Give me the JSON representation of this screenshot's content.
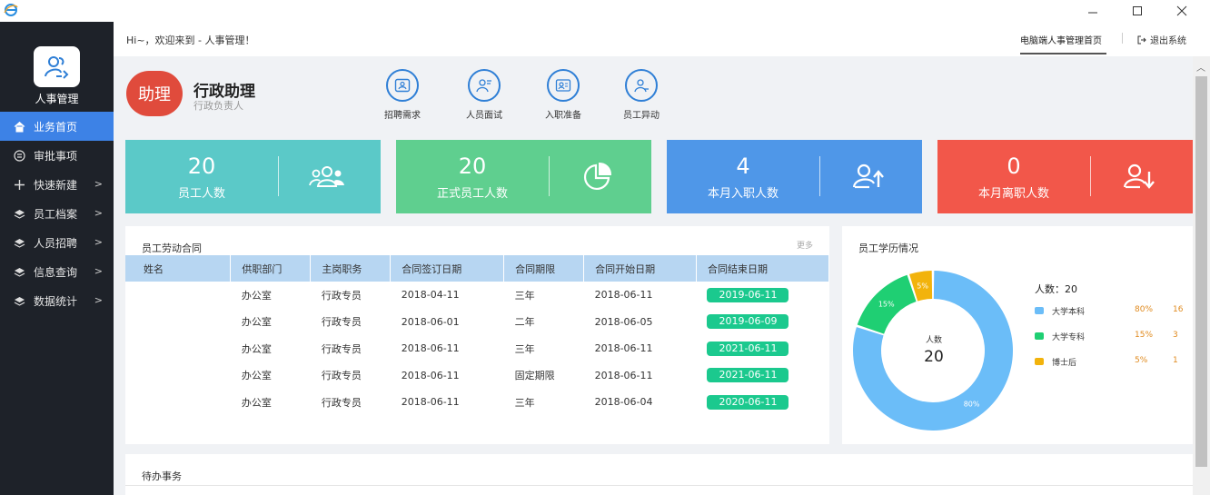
{
  "window": {
    "controls": [
      "minimize-icon",
      "maximize-icon",
      "close-icon"
    ]
  },
  "sidebar": {
    "logo_title": "人事管理",
    "items": [
      {
        "label": "业务首页",
        "icon": "home-icon",
        "active": true,
        "has_chevron": false
      },
      {
        "label": "审批事项",
        "icon": "list-icon",
        "active": false,
        "has_chevron": false
      },
      {
        "label": "快速新建",
        "icon": "plus-icon",
        "active": false,
        "has_chevron": true
      },
      {
        "label": "员工档案",
        "icon": "layers-icon",
        "active": false,
        "has_chevron": true
      },
      {
        "label": "人员招聘",
        "icon": "layers-icon",
        "active": false,
        "has_chevron": true
      },
      {
        "label": "信息查询",
        "icon": "layers-icon",
        "active": false,
        "has_chevron": true
      },
      {
        "label": "数据统计",
        "icon": "layers-icon",
        "active": false,
        "has_chevron": true
      }
    ],
    "chevron": ">"
  },
  "header": {
    "greeting": "Hi~，欢迎来到 - 人事管理！",
    "nav_home": "电脑端人事管理首页",
    "logout": "退出系统"
  },
  "profile": {
    "badge": "助理",
    "name": "行政助理",
    "role": "行政负责人"
  },
  "quick_actions": [
    {
      "label": "招聘需求",
      "icon": "recruit-icon"
    },
    {
      "label": "人员面试",
      "icon": "interview-icon"
    },
    {
      "label": "入职准备",
      "icon": "onboard-icon"
    },
    {
      "label": "员工异动",
      "icon": "transfer-icon"
    }
  ],
  "stats": [
    {
      "value": "20",
      "label": "员工人数",
      "color": "#5bc9c8",
      "icon": "group-icon"
    },
    {
      "value": "20",
      "label": "正式员工人数",
      "color": "#5fcf8f",
      "icon": "pie-icon"
    },
    {
      "value": "4",
      "label": "本月入职人数",
      "color": "#4f97e8",
      "icon": "user-up-icon"
    },
    {
      "value": "0",
      "label": "本月离职人数",
      "color": "#f2574a",
      "icon": "user-down-icon"
    }
  ],
  "contracts": {
    "title": "员工劳动合同",
    "more": "更多",
    "columns": [
      "姓名",
      "供职部门",
      "主岗职务",
      "合同签订日期",
      "合同期限",
      "合同开始日期",
      "合同结束日期"
    ],
    "rows": [
      [
        "",
        "办公室",
        "行政专员",
        "2018-04-11",
        "三年",
        "2018-06-11",
        "2019-06-11"
      ],
      [
        "",
        "办公室",
        "行政专员",
        "2018-06-01",
        "二年",
        "2018-06-05",
        "2019-06-09"
      ],
      [
        "",
        "办公室",
        "行政专员",
        "2018-06-11",
        "三年",
        "2018-06-11",
        "2021-06-11"
      ],
      [
        "",
        "办公室",
        "行政专员",
        "2018-06-11",
        "固定期限",
        "2018-06-11",
        "2021-06-11"
      ],
      [
        "",
        "办公室",
        "行政专员",
        "2018-06-11",
        "三年",
        "2018-06-04",
        "2020-06-11"
      ]
    ]
  },
  "education": {
    "title": "员工学历情况",
    "center_label": "人数",
    "center_value": "20",
    "total_label": "人数：20",
    "legend": [
      {
        "name": "大学本科",
        "pct": "80%",
        "count": "16",
        "color": "#6bbdf8"
      },
      {
        "name": "大学专科",
        "pct": "15%",
        "count": "3",
        "color": "#1fcf73"
      },
      {
        "name": "博士后",
        "pct": "5%",
        "count": "1",
        "color": "#f2b30c"
      }
    ]
  },
  "chart_data": {
    "type": "pie",
    "categories": [
      "大学本科",
      "大学专科",
      "博士后"
    ],
    "values": [
      16,
      3,
      1
    ],
    "labels": [
      "80%",
      "15%",
      "5%"
    ],
    "title": "员工学历情况"
  },
  "todo": {
    "title": "待办事务"
  }
}
